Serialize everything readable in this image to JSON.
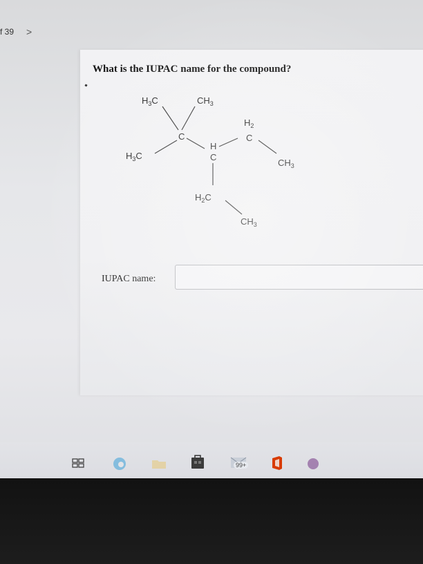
{
  "nav": {
    "page_indicator": "f 39",
    "next_glyph": ">"
  },
  "question": {
    "prompt": "What is the IUPAC name for the compound?"
  },
  "structure": {
    "labels": {
      "ch3_top_left": "H3C",
      "ch3_top_right": "CH3",
      "ch3_left": "H3C",
      "c_quaternary": "C",
      "ch_carbon_h": "H",
      "ch_carbon_c": "C",
      "ch2_top_h": "H2",
      "ch2_top_c": "C",
      "ch3_right": "CH3",
      "ch2_bottom": "H2C",
      "ch3_bottom": "CH3"
    }
  },
  "answer": {
    "label": "IUPAC name:",
    "value": ""
  },
  "taskbar": {
    "notification_badge": "99+",
    "icons": [
      "task-view-icon",
      "edge-icon",
      "file-explorer-icon",
      "store-icon",
      "mail-icon",
      "office-icon",
      "app-icon"
    ]
  },
  "colors": {
    "screen_bg": "#e6e7ea",
    "text": "#111111",
    "taskbar_bg": "#dcdde2",
    "office_red": "#d83b01",
    "edge_blue": "#1e88c9"
  }
}
